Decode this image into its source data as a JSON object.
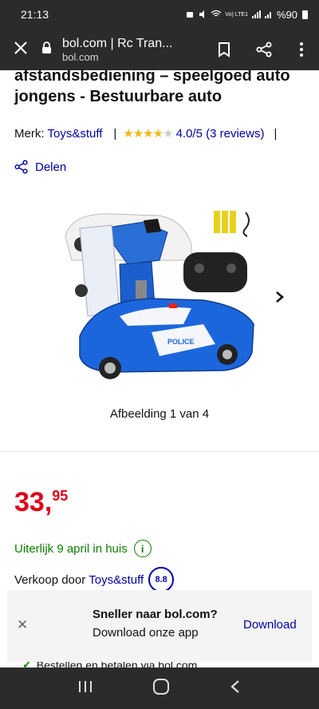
{
  "status": {
    "time": "21:13",
    "network": "Vo) LTE1",
    "battery": "%90"
  },
  "browser": {
    "tab_title": "bol.com | Rc Tran...",
    "host": "bol.com"
  },
  "product": {
    "title": "afstandsbediening – speelgoed auto jongens - Bestuurbare auto",
    "brand_label": "Merk:",
    "brand": "Toys&stuff",
    "rating_text": "4.0/5 (3 reviews)",
    "stars_filled": 4,
    "stars_total": 5,
    "share_label": "Delen",
    "image_caption": "Afbeelding 1 van 4",
    "price_main": "33,",
    "price_cents": "95",
    "delivery": "Uiterlijk 9 april in huis",
    "seller_label": "Verkoop door",
    "seller": "Toys&stuff",
    "seller_rating": "8.8",
    "peek_text": "Bestellen en betalen via bol.com"
  },
  "banner": {
    "title": "Sneller naar bol.com?",
    "subtitle": "Download onze app",
    "download": "Download"
  },
  "image_badge_text": "POLICE",
  "icons": [
    "close-icon",
    "lock-icon",
    "bookmark-icon",
    "share-icon",
    "menu-icon",
    "chevron-right-icon",
    "info-icon",
    "check-icon",
    "nav-recent-icon",
    "nav-home-icon",
    "nav-back-icon"
  ],
  "colors": {
    "price": "#e0001b",
    "link": "#0000a4",
    "delivery": "#0b7f00",
    "star": "#f3b81b",
    "chrome": "#2b2b2b"
  }
}
